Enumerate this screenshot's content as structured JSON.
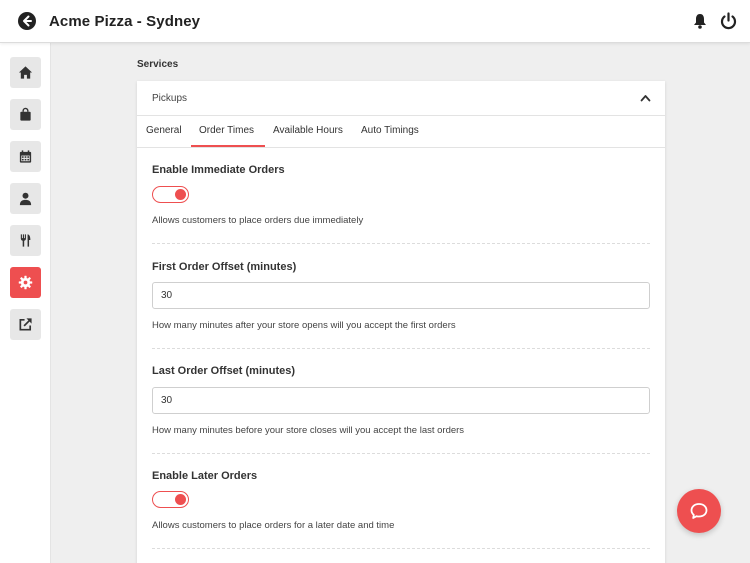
{
  "header": {
    "title": "Acme Pizza - Sydney",
    "back_icon": "arrow-left-circle-icon",
    "notifications_icon": "bell-icon",
    "power_icon": "power-icon"
  },
  "sidebar": {
    "items": [
      {
        "icon": "home-icon",
        "active": false
      },
      {
        "icon": "shopping-bag-icon",
        "active": false
      },
      {
        "icon": "calendar-icon",
        "active": false
      },
      {
        "icon": "user-icon",
        "active": false
      },
      {
        "icon": "utensils-icon",
        "active": false
      },
      {
        "icon": "gear-icon",
        "active": true
      },
      {
        "icon": "external-link-icon",
        "active": false
      }
    ]
  },
  "section": {
    "title": "Services"
  },
  "panel": {
    "title": "Pickups",
    "collapse_icon": "chevron-up-icon",
    "tabs": [
      {
        "label": "General",
        "active": false
      },
      {
        "label": "Order Times",
        "active": true
      },
      {
        "label": "Available Hours",
        "active": false
      },
      {
        "label": "Auto Timings",
        "active": false
      }
    ]
  },
  "form": {
    "enable_immediate": {
      "title": "Enable Immediate Orders",
      "enabled": true,
      "description": "Allows customers to place orders due immediately"
    },
    "first_offset": {
      "title": "First Order Offset (minutes)",
      "value": "30",
      "description": "How many minutes after your store opens will you accept the first orders"
    },
    "last_offset": {
      "title": "Last Order Offset (minutes)",
      "value": "30",
      "description": "How many minutes before your store closes will you accept the last orders"
    },
    "enable_later": {
      "title": "Enable Later Orders",
      "enabled": true,
      "description": "Allows customers to place orders for a later date and time"
    }
  },
  "support": {
    "icon": "chat-bubble-icon"
  },
  "colors": {
    "accent": "#ee4f50",
    "background": "#efefef",
    "surface": "#ffffff"
  }
}
